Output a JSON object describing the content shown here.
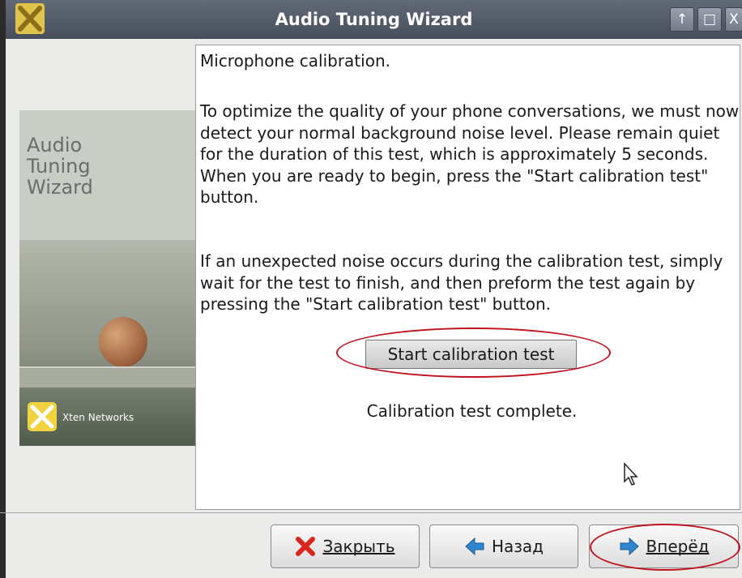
{
  "window": {
    "title": "Audio Tuning Wizard",
    "controls": [
      "↑",
      "□",
      "X"
    ]
  },
  "sidebar": {
    "heading": "Audio\nTuning\nWizard",
    "brand": "Xten Networks"
  },
  "main": {
    "heading": "Microphone calibration.",
    "paragraph1": "To optimize the quality of your phone conversations, we must now detect your normal background noise level. Please remain quiet for the duration of this test, which is approximately 5 seconds.  When you are ready to begin, press the \"Start calibration test\" button.",
    "paragraph2": "If an unexpected noise occurs during the calibration test, simply wait for the test to finish, and then preform the test again by pressing the \"Start calibration test\" button.",
    "start_button": "Start calibration test",
    "status": "Calibration test complete."
  },
  "footer": {
    "close_label": "Закрыть",
    "back_label": "Назад",
    "next_label": "Вперёд"
  },
  "colors": {
    "highlight": "#c0121e",
    "close_icon": "#d9261c",
    "arrow_icon": "#2e86d1"
  }
}
